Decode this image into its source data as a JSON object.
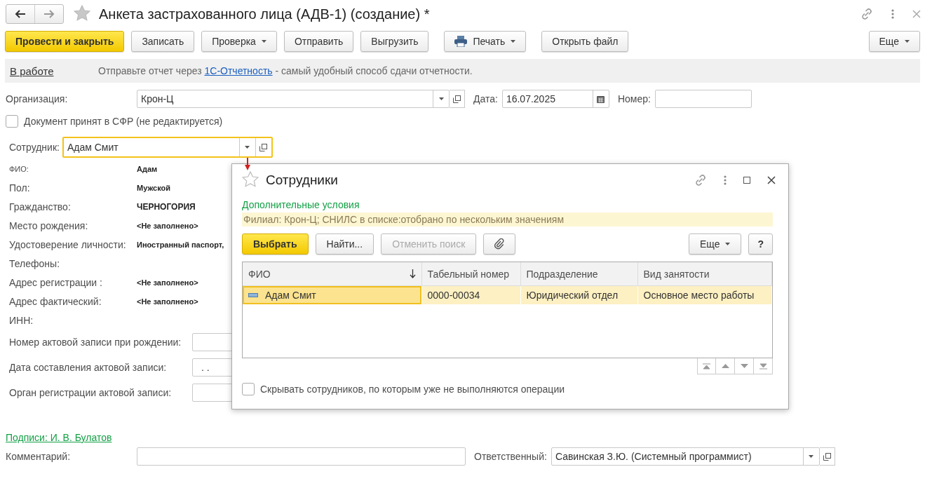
{
  "window": {
    "title": "Анкета застрахованного лица (АДВ-1) (создание) *"
  },
  "toolbar": {
    "buttons": [
      {
        "label": "Провести и закрыть",
        "kind": "primary"
      },
      {
        "label": "Записать",
        "kind": "plain"
      },
      {
        "label": "Проверка",
        "kind": "dropdown"
      },
      {
        "label": "Отправить",
        "kind": "plain"
      },
      {
        "label": "Выгрузить",
        "kind": "plain"
      },
      {
        "label": "Печать",
        "kind": "print"
      },
      {
        "label": "Открыть файл",
        "kind": "plain"
      }
    ],
    "more": "Еще"
  },
  "status_bar": {
    "state": "В работе",
    "message_before": "Отправьте отчет через ",
    "link": "1С-Отчетность",
    "message_after": " - самый удобный способ сдачи отчетности."
  },
  "organization": {
    "label": "Организация:",
    "value": "Крон-Ц"
  },
  "date": {
    "label": "Дата:",
    "value": "16.07.2025"
  },
  "number": {
    "label": "Номер:"
  },
  "accepted": {
    "label": "Документ принят в СФР (не редактируется)",
    "checked": false
  },
  "employee": {
    "label": "Сотрудник:",
    "value": "Адам Смит"
  },
  "details": [
    {
      "label": "ФИО:",
      "value": "Адам",
      "kind": "small"
    },
    {
      "label": "Пол:",
      "value": "Мужской",
      "kind": "small"
    },
    {
      "label": "Гражданство:",
      "value": "ЧЕРНОГОРИЯ",
      "kind": "normal"
    },
    {
      "label": "Место рождения:",
      "value": "<Не заполнено>",
      "kind": "small"
    },
    {
      "label": "Удостоверение личности:",
      "value": "Иностранный паспорт,",
      "kind": "small"
    },
    {
      "label": "Телефоны:"
    },
    {
      "label": "Адрес регистрации :",
      "value": "<Не заполнено>",
      "kind": "small"
    },
    {
      "label": "Адрес фактический:",
      "value": "<Не заполнено>",
      "kind": "small"
    },
    {
      "label": "ИНН:"
    }
  ],
  "record_fields": [
    {
      "label": "Номер актовой записи при рождении:"
    },
    {
      "label": "Дата составления актовой записи:",
      "value": ". ."
    },
    {
      "label": "Орган регистрации актовой записи:"
    }
  ],
  "signatures_link": "Подписи: И. В. Булатов",
  "comment": {
    "label": "Комментарий:"
  },
  "responsible": {
    "label": "Ответственный:",
    "value": "Савинская З.Ю. (Системный программист)"
  },
  "dialog": {
    "title": "Сотрудники",
    "conditions_link": "Дополнительные условия",
    "filter": "Филиал: Крон-Ц; СНИЛС в списке:отобрано по нескольким значениям",
    "buttons": [
      {
        "label": "Выбрать",
        "kind": "primary",
        "disabled": false
      },
      {
        "label": "Найти...",
        "kind": "plain",
        "disabled": false
      },
      {
        "label": "Отменить поиск",
        "kind": "plain",
        "disabled": true
      }
    ],
    "more": "Еще",
    "help": "?",
    "table": {
      "columns": [
        "ФИО",
        "Табельный номер",
        "Подразделение",
        "Вид занятости"
      ],
      "rows": [
        {
          "cells": [
            "Адам Смит",
            "0000-00034",
            "Юридический отдел",
            "Основное место работы"
          ],
          "selected": true
        }
      ]
    },
    "hide_inactive": {
      "label": "Скрывать сотрудников, по которым уже не выполняются операции",
      "checked": false
    }
  }
}
